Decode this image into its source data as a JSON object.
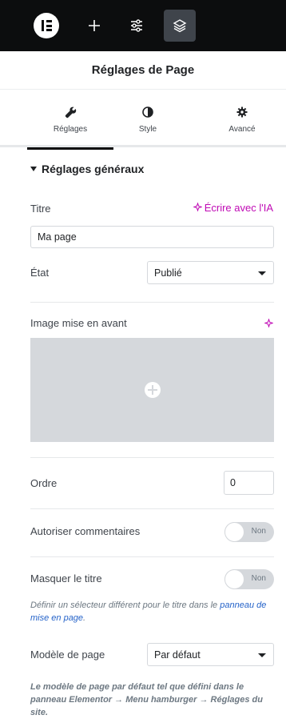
{
  "topbar": {
    "logo_icon": "elementor-logo-icon",
    "add_icon": "plus-icon",
    "settings_icon": "sliders-icon",
    "structure_icon": "layers-icon"
  },
  "panel": {
    "title": "Réglages de Page"
  },
  "tabs": [
    {
      "label": "Réglages",
      "icon": "wrench-icon",
      "active": true
    },
    {
      "label": "Style",
      "icon": "half-circle-icon",
      "active": false
    },
    {
      "label": "Avancé",
      "icon": "gear-icon",
      "active": false
    }
  ],
  "section": {
    "title": "Réglages généraux"
  },
  "fields": {
    "title": {
      "label": "Titre",
      "value": "Ma page",
      "ai_label": "Écrire avec l'IA"
    },
    "status": {
      "label": "État",
      "value": "Publié"
    },
    "featured_image": {
      "label": "Image mise en avant"
    },
    "order": {
      "label": "Ordre",
      "value": "0"
    },
    "comments": {
      "label": "Autoriser commentaires",
      "toggle_text": "Non"
    },
    "hide_title": {
      "label": "Masquer le titre",
      "toggle_text": "Non",
      "help_prefix": "Définir un sélecteur différent pour le titre dans le ",
      "help_link": "panneau de mise en page",
      "help_suffix": "."
    },
    "template": {
      "label": "Modèle de page",
      "value": "Par défaut",
      "help": "Le modèle de page par défaut tel que défini dans le panneau Elementor → Menu hamburger → Réglages du site."
    }
  },
  "colors": {
    "accent_ai": "#c00bb5",
    "link": "#2563c9",
    "topbar_bg": "#0c0d0e"
  }
}
